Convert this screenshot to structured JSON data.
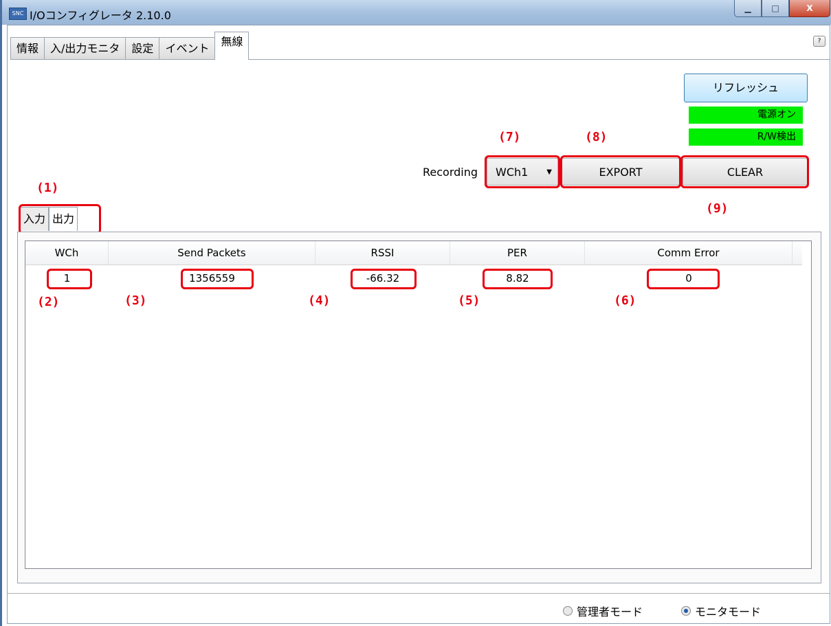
{
  "window": {
    "title": "I/Oコンフィグレータ 2.10.0",
    "minimize": "▁",
    "maximize": "□",
    "close": "X",
    "app_icon": "SNC"
  },
  "tabs": [
    "情報",
    "入/出力モニタ",
    "設定",
    "イベント",
    "無線"
  ],
  "active_tab": "無線",
  "help": "?",
  "refresh_label": "リフレッシュ",
  "status": {
    "power": "電源オン",
    "rw": "R/W検出",
    "color": "#00ee00"
  },
  "recording": {
    "label": "Recording",
    "selected": "WCh1"
  },
  "buttons": {
    "export": "EXPORT",
    "clear": "CLEAR"
  },
  "subtabs": [
    "入力",
    "出力"
  ],
  "table": {
    "columns": [
      "WCh",
      "Send Packets",
      "RSSI",
      "PER",
      "Comm Error"
    ],
    "rows": [
      {
        "wch": "1",
        "send_packets": "1356559",
        "rssi": "-66.32",
        "per": "8.82",
        "comm_error": "0"
      }
    ]
  },
  "annotations": {
    "a1": "(1)",
    "a2": "(2)",
    "a3": "(3)",
    "a4": "(4)",
    "a5": "(5)",
    "a6": "(6)",
    "a7": "(7)",
    "a8": "(8)",
    "a9": "(9)",
    "color": "#e8000f"
  },
  "mode": {
    "admin": "管理者モード",
    "monitor": "モニタモード",
    "selected": "モニタモード"
  }
}
